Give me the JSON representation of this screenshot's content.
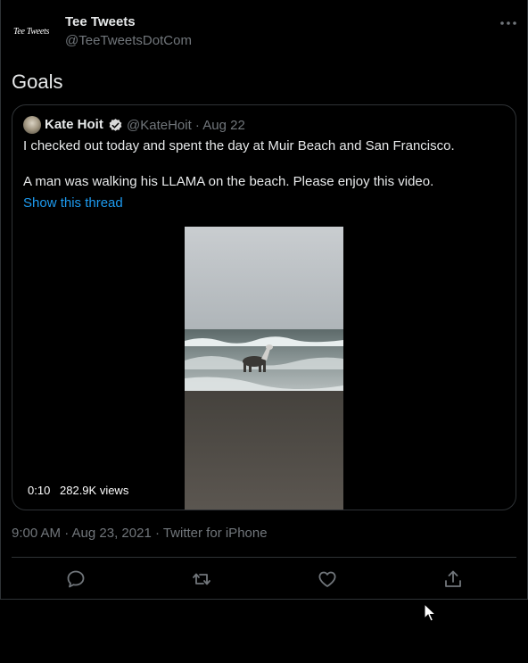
{
  "tweet": {
    "author": {
      "logo_text": "Tee Tweets",
      "name": "Tee Tweets",
      "handle": "@TeeTweetsDotCom",
      "avatar_icon": "tee-tweets-logo"
    },
    "text": "Goals",
    "quoted": {
      "author_name": "Kate Hoit",
      "handle_date": "@KateHoit · Aug 22",
      "verified_icon": "verified-badge-icon",
      "line1": "I checked out today and spent the day at Muir Beach and San Francisco.",
      "line2": "A man was walking his LLAMA on the beach. Please enjoy this video.",
      "show_thread": "Show this thread",
      "video": {
        "duration": "0:10",
        "views": "282.9K views"
      }
    },
    "meta": "9:00 AM · Aug 23, 2021 · Twitter for iPhone",
    "actions": [
      "reply-icon",
      "retweet-icon",
      "like-icon",
      "share-icon"
    ]
  },
  "colors": {
    "background": "#000000",
    "text": "#e7e9ea",
    "muted": "#71767b",
    "link": "#1d9bf0",
    "border": "#2f3336"
  }
}
